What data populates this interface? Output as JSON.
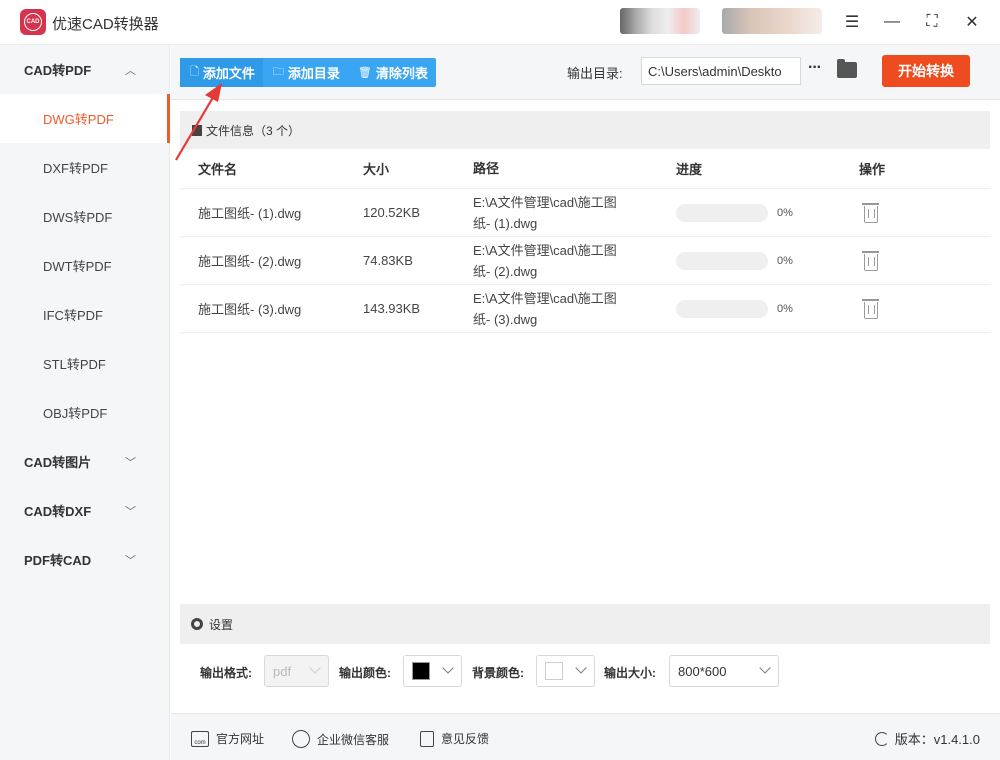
{
  "app": {
    "title": "优速CAD转换器",
    "logo_text": "CAD"
  },
  "sidebar": {
    "groups": [
      {
        "label": "CAD转PDF",
        "expanded": true,
        "items": [
          "DWG转PDF",
          "DXF转PDF",
          "DWS转PDF",
          "DWT转PDF",
          "IFC转PDF",
          "STL转PDF",
          "OBJ转PDF"
        ],
        "active": "DWG转PDF"
      },
      {
        "label": "CAD转图片",
        "expanded": false
      },
      {
        "label": "CAD转DXF",
        "expanded": false
      },
      {
        "label": "PDF转CAD",
        "expanded": false
      }
    ]
  },
  "toolbar": {
    "add_file": "添加文件",
    "add_dir": "添加目录",
    "clear_list": "清除列表",
    "output_dir_label": "输出目录:",
    "output_dir_value": "C:\\Users\\admin\\Deskto",
    "more": "···",
    "start": "开始转换"
  },
  "file_panel": {
    "title": "文件信息（3 个）",
    "columns": [
      "文件名",
      "大小",
      "路径",
      "进度",
      "操作"
    ],
    "rows": [
      {
        "name": "施工图纸- (1).dwg",
        "size": "120.52KB",
        "path_line1": "E:\\A文件管理\\cad\\施工图",
        "path_line2": "纸- (1).dwg",
        "progress": 0,
        "progress_text": "0%"
      },
      {
        "name": "施工图纸- (2).dwg",
        "size": "74.83KB",
        "path_line1": "E:\\A文件管理\\cad\\施工图",
        "path_line2": "纸- (2).dwg",
        "progress": 0,
        "progress_text": "0%"
      },
      {
        "name": "施工图纸- (3).dwg",
        "size": "143.93KB",
        "path_line1": "E:\\A文件管理\\cad\\施工图",
        "path_line2": "纸- (3).dwg",
        "progress": 0,
        "progress_text": "0%"
      }
    ]
  },
  "settings": {
    "title": "设置",
    "format_label": "输出格式:",
    "format_value": "pdf",
    "color_label": "输出颜色:",
    "color_value": "#000000",
    "bg_label": "背景颜色:",
    "bg_value": "#ffffff",
    "size_label": "输出大小:",
    "size_value": "800*600"
  },
  "footer": {
    "website": "官方网址",
    "wechat": "企业微信客服",
    "feedback": "意见反馈",
    "version": "版本：v1.4.1.0"
  },
  "colors": {
    "accent": "#3aa6f3",
    "active": "#f05a2c",
    "start": "#ee4b1f",
    "annotation": "#e53935"
  }
}
